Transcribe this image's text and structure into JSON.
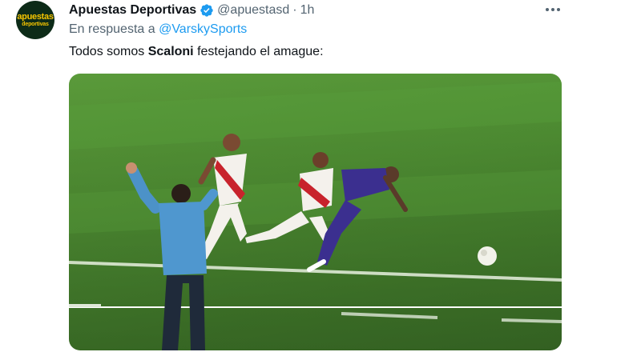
{
  "tweet": {
    "avatar": {
      "logo_top": "apuestas",
      "logo_bottom": "deportivas"
    },
    "display_name": "Apuestas Deportivas",
    "verified": true,
    "handle": "@apuestasd",
    "separator": "·",
    "time": "1h",
    "reply_prefix": "En respuesta a",
    "reply_mention": "@VarskySports",
    "text_before": "Todos somos ",
    "text_bold": "Scaloni",
    "text_after": " festejando el amague:",
    "colors": {
      "accent": "#1d9bf0",
      "secondary_text": "#536471",
      "primary_text": "#0f1419",
      "pitch": "#4f8f33"
    },
    "icons": [
      "verified-badge-icon",
      "more-options-icon"
    ]
  }
}
